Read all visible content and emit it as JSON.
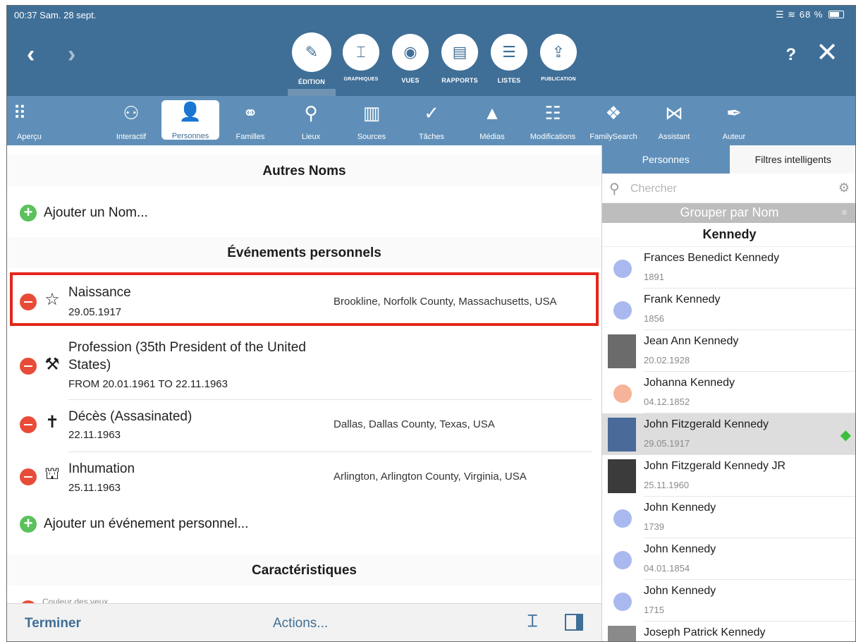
{
  "status": {
    "time_date": "00:37  Sam. 28 sept.",
    "battery": "68 %"
  },
  "header": {
    "modes": [
      {
        "label": "ÉDITION",
        "icon": "pencil-icon",
        "glyph": "✎"
      },
      {
        "label": "GRAPHIQUES",
        "icon": "chart-tree-icon",
        "glyph": "⌶"
      },
      {
        "label": "VUES",
        "icon": "eye-icon",
        "glyph": "◉"
      },
      {
        "label": "RAPPORTS",
        "icon": "document-icon",
        "glyph": "▤"
      },
      {
        "label": "LISTES",
        "icon": "list-document-icon",
        "glyph": "☰"
      },
      {
        "label": "PUBLICATION",
        "icon": "share-upload-icon",
        "glyph": "⇪"
      }
    ],
    "help": "?",
    "close": "✕",
    "back": "‹",
    "forward": "›"
  },
  "toolbar": [
    {
      "label": "Aperçu",
      "icon": "grid-dots-icon",
      "glyph": "⠿"
    },
    {
      "label": "Interactif",
      "icon": "family-tree-icon",
      "glyph": "⚇"
    },
    {
      "label": "Personnes",
      "icon": "person-icon",
      "glyph": "👤"
    },
    {
      "label": "Familles",
      "icon": "rings-icon",
      "glyph": "⚭"
    },
    {
      "label": "Lieux",
      "icon": "location-pin-icon",
      "glyph": "⚲"
    },
    {
      "label": "Sources",
      "icon": "sources-icon",
      "glyph": "▥"
    },
    {
      "label": "Tâches",
      "icon": "checkmark-circle-icon",
      "glyph": "✓"
    },
    {
      "label": "Médias",
      "icon": "media-icon",
      "glyph": "▲"
    },
    {
      "label": "Modifications",
      "icon": "list-icon",
      "glyph": "☷"
    },
    {
      "label": "FamilySearch",
      "icon": "familysearch-tree-icon",
      "glyph": "❖"
    },
    {
      "label": "Assistant",
      "icon": "bowtie-icon",
      "glyph": "⋈"
    },
    {
      "label": "Auteur",
      "icon": "pen-nib-icon",
      "glyph": "✒"
    }
  ],
  "main": {
    "other_names_title": "Autres Noms",
    "add_name": "Ajouter un Nom...",
    "events_title": "Événements personnels",
    "events": [
      {
        "title": "Naissance",
        "date": "29.05.1917",
        "place": "Brookline, Norfolk County, Massachusetts, USA",
        "icon": "star-icon",
        "glyph": "☆"
      },
      {
        "title": "Profession (35th President of the United States)",
        "date": "FROM 20.01.1961 TO 22.11.1963",
        "place": "",
        "icon": "hammer-icon",
        "glyph": "⚒"
      },
      {
        "title": "Décès (Assasinated)",
        "date": "22.11.1963",
        "place": "Dallas, Dallas County, Texas, USA",
        "icon": "cross-icon",
        "glyph": "✝"
      },
      {
        "title": "Inhumation",
        "date": "25.11.1963",
        "place": "Arlington, Arlington County, Virginia, USA",
        "icon": "tombstone-icon",
        "glyph": "⛫"
      }
    ],
    "add_event": "Ajouter un événement personnel...",
    "characteristics_title": "Caractéristiques",
    "eye_color_label": "Couleur des yeux"
  },
  "bottom": {
    "done": "Terminer",
    "actions": "Actions..."
  },
  "sidebar": {
    "tabs": [
      "Personnes",
      "Filtres intelligents"
    ],
    "search_placeholder": "Chercher",
    "group_by": "Grouper par Nom",
    "letter_header": "Kennedy",
    "persons": [
      {
        "name": "Frances Benedict Kennedy",
        "date": "1891",
        "avatar": "dot",
        "color": "#a9b9f0"
      },
      {
        "name": "Frank Kennedy",
        "date": "1856",
        "avatar": "dot",
        "color": "#a9b9f0"
      },
      {
        "name": "Jean Ann Kennedy",
        "date": "20.02.1928",
        "avatar": "photo",
        "color": "#6b6b6b"
      },
      {
        "name": "Johanna Kennedy",
        "date": "04.12.1852",
        "avatar": "dot",
        "color": "#f5b49a"
      },
      {
        "name": "John Fitzgerald Kennedy",
        "date": "29.05.1917",
        "avatar": "photo",
        "color": "#4a6a9a",
        "selected": true
      },
      {
        "name": "John Fitzgerald Kennedy JR",
        "date": "25.11.1960",
        "avatar": "photo",
        "color": "#3b3b3b"
      },
      {
        "name": "John Kennedy",
        "date": "1739",
        "avatar": "dot",
        "color": "#a9b9f0"
      },
      {
        "name": "John Kennedy",
        "date": "04.01.1854",
        "avatar": "dot",
        "color": "#a9b9f0"
      },
      {
        "name": "John Kennedy",
        "date": "1715",
        "avatar": "dot",
        "color": "#a9b9f0"
      },
      {
        "name": "Joseph Patrick Kennedy",
        "date": "",
        "avatar": "photo",
        "color": "#8a8a8a"
      }
    ]
  },
  "colors": {
    "header": "#3f6f97",
    "toolbar": "#5f8fb8",
    "highlight": "#e3261b",
    "add": "#5cc15c",
    "remove": "#e84c38"
  }
}
